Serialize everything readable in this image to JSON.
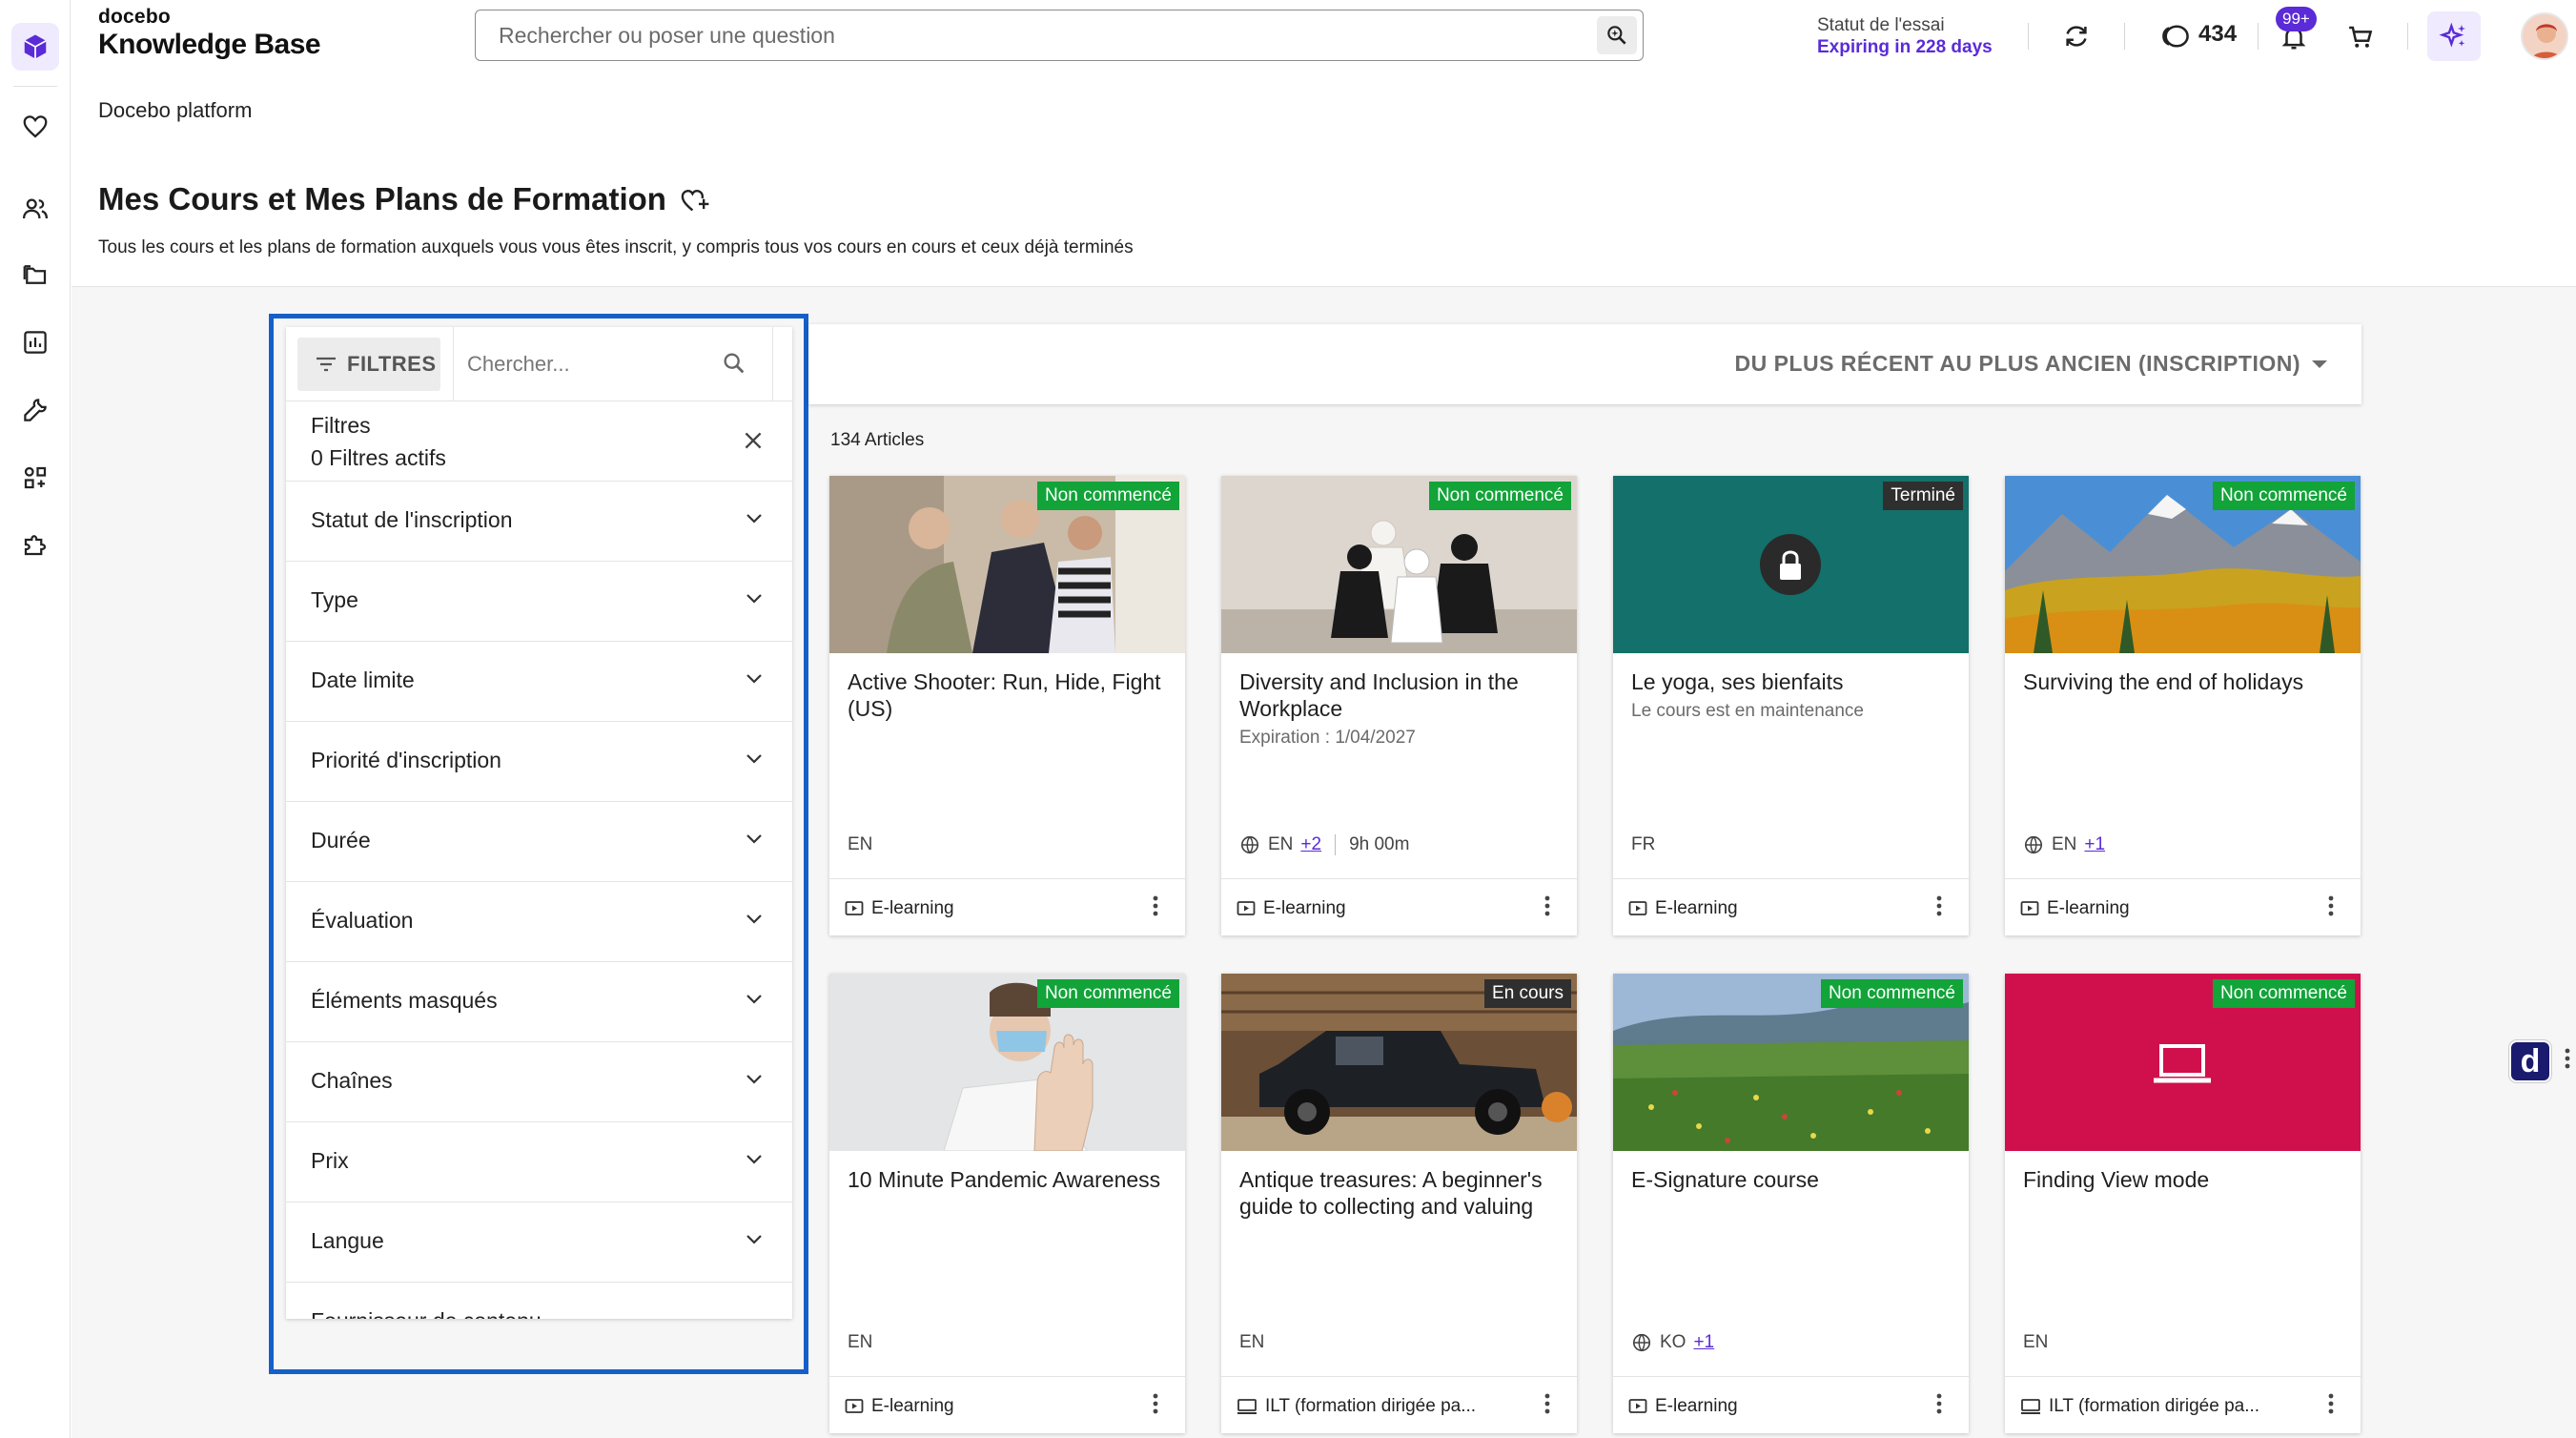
{
  "brand": {
    "small": "docebo",
    "name": "Knowledge Base"
  },
  "search": {
    "placeholder": "Rechercher ou poser une question"
  },
  "trial": {
    "label": "Statut de l'essai",
    "expiry": "Expiring in 228 days"
  },
  "coins": "434",
  "notifications_badge": "99+",
  "breadcrumb": "Docebo platform",
  "page": {
    "title": "Mes Cours et Mes Plans de Formation",
    "description": "Tous les cours et les plans de formation auxquels vous vous êtes inscrit, y compris tous vos cours en cours et ceux déjà terminés"
  },
  "filters": {
    "button_label": "FILTRES",
    "search_placeholder": "Chercher...",
    "heading": "Filtres",
    "active_count": "0 Filtres actifs",
    "items": [
      "Statut de l'inscription",
      "Type",
      "Date limite",
      "Priorité d'inscription",
      "Durée",
      "Évaluation",
      "Éléments masqués",
      "Chaînes",
      "Prix",
      "Langue",
      "Fournisseur de contenu"
    ]
  },
  "sort": {
    "label": "DU PLUS RÉCENT AU PLUS ANCIEN (INSCRIPTION)"
  },
  "results_count": "134 Articles",
  "courses": [
    {
      "title": "Active Shooter: Run, Hide, Fight (US)",
      "status": "Non commencé",
      "subtitle": "",
      "lang": "EN",
      "lang_more": "",
      "duration": "",
      "type": "E-learning"
    },
    {
      "title": "Diversity and Inclusion in the Workplace",
      "status": "Non commencé",
      "subtitle": "Expiration : 1/04/2027",
      "lang": "EN",
      "lang_more": "+2",
      "duration": "9h 00m",
      "type": "E-learning"
    },
    {
      "title": "Le yoga, ses bienfaits",
      "status": "Terminé",
      "subtitle": "Le cours est en maintenance",
      "lang": "FR",
      "lang_more": "",
      "duration": "",
      "type": "E-learning"
    },
    {
      "title": "Surviving the end of holidays",
      "status": "Non commencé",
      "subtitle": "",
      "lang": "EN",
      "lang_more": "+1",
      "duration": "",
      "type": "E-learning"
    },
    {
      "title": "10 Minute Pandemic Awareness",
      "status": "Non commencé",
      "subtitle": "",
      "lang": "EN",
      "lang_more": "",
      "duration": "",
      "type": "E-learning"
    },
    {
      "title": "Antique treasures: A beginner's guide to collecting and valuing",
      "status": "En cours",
      "subtitle": "",
      "lang": "EN",
      "lang_more": "",
      "duration": "",
      "type": "ILT (formation dirigée pa..."
    },
    {
      "title": "E-Signature course",
      "status": "Non commencé",
      "subtitle": "",
      "lang": "KO",
      "lang_more": "+1",
      "duration": "",
      "type": "E-learning"
    },
    {
      "title": "Finding View mode",
      "status": "Non commencé",
      "subtitle": "",
      "lang": "EN",
      "lang_more": "",
      "duration": "",
      "type": "ILT (formation dirigée pa..."
    }
  ],
  "colors": {
    "accent": "#5a2bd6",
    "status_green": "#12a339",
    "highlight_outline": "#1560c8",
    "teal": "#13706a",
    "crimson": "#d0104c"
  }
}
